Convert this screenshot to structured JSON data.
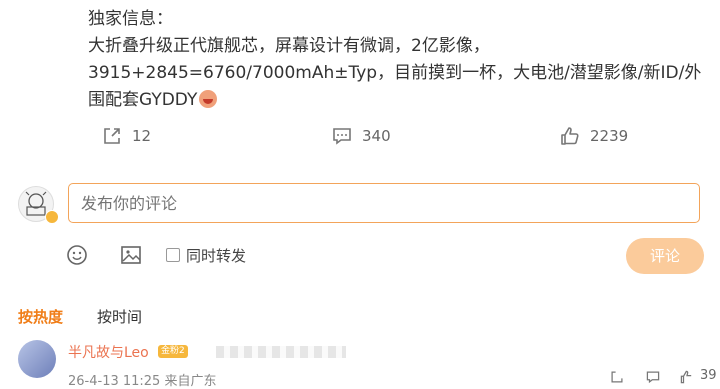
{
  "post": {
    "line1": "独家信息：",
    "line2": "大折叠升级正代旗舰芯，屏幕设计有微调，2亿影像，",
    "line3": "3915+2845=6760/7000mAh±Typ，目前摸到一杯，大电池/潜望影像/新ID/外",
    "line4": "围配套GYDDY"
  },
  "actions": {
    "repost_count": "12",
    "comment_count": "340",
    "like_count": "2239"
  },
  "composer": {
    "placeholder": "发布你的评论",
    "repost_label": "同时转发",
    "submit_label": "评论"
  },
  "sort": {
    "hot_label": "按热度",
    "time_label": "按时间"
  },
  "comment": {
    "author": "半凡故与Leo",
    "badge": "金粉2",
    "meta": "26-4-13 11:25 来自广东",
    "like_count": "39"
  },
  "colors": {
    "accent": "#f07d17",
    "input_border": "#f3a45a",
    "submit_bg": "#fbcb9b",
    "author_name": "#eb7350"
  }
}
